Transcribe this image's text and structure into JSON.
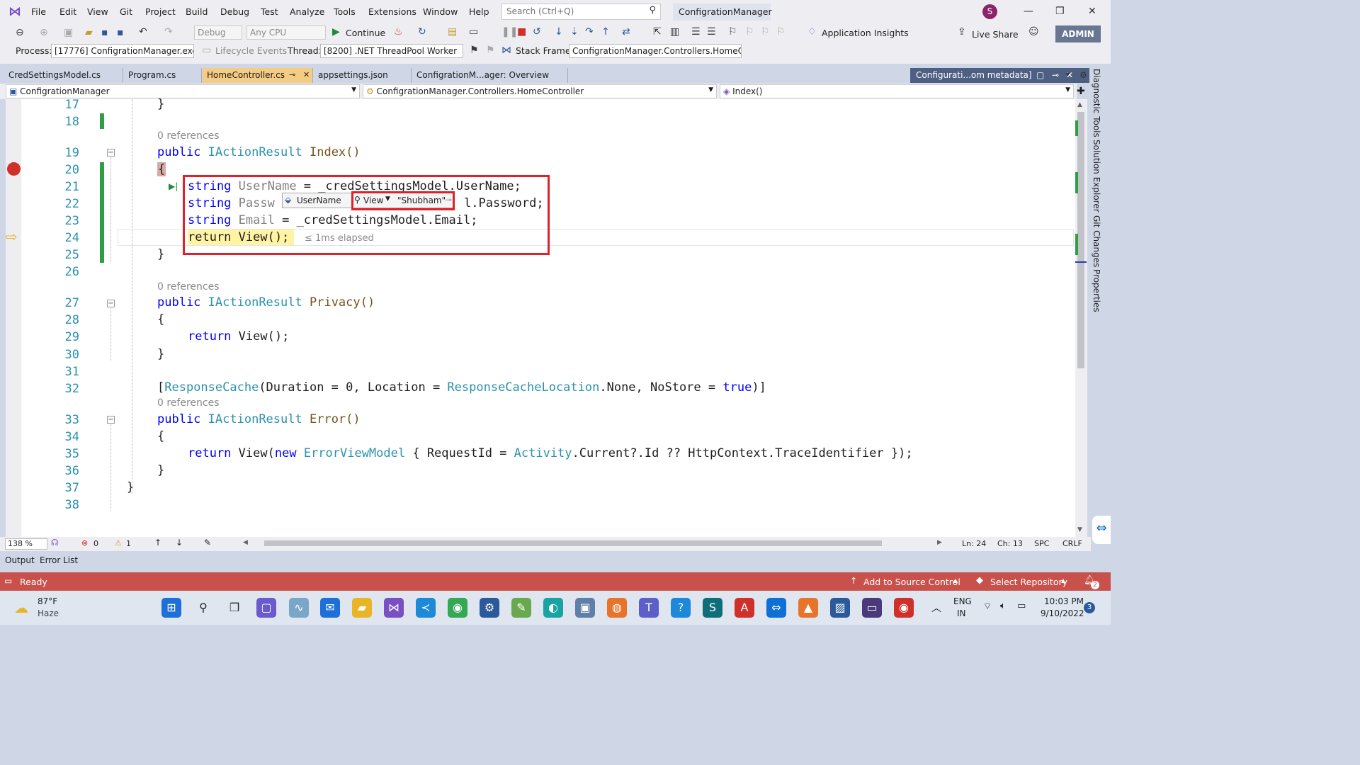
{
  "menu": [
    "File",
    "Edit",
    "View",
    "Git",
    "Project",
    "Build",
    "Debug",
    "Test",
    "Analyze",
    "Tools",
    "Extensions",
    "Window",
    "Help"
  ],
  "search_placeholder": "Search (Ctrl+Q)",
  "solution_name": "ConfigrationManager",
  "avatar_letter": "S",
  "toolbar": {
    "config": "Debug",
    "platform": "Any CPU",
    "continue": "Continue",
    "app_insights": "Application Insights",
    "live_share": "Live Share",
    "admin": "ADMIN"
  },
  "debugbar": {
    "process_label": "Process:",
    "process": "[17776] ConfigrationManager.exe",
    "lifecycle": "Lifecycle Events",
    "thread_label": "Thread:",
    "thread": "[8200] .NET ThreadPool Worker",
    "stack_label": "Stack Frame:",
    "stack": "ConfigrationManager.Controllers.HomeCc"
  },
  "tabs": [
    "CredSettingsModel.cs",
    "Program.cs",
    "HomeController.cs",
    "appsettings.json",
    "ConfigrationM...ager: Overview"
  ],
  "tab_right": "Configurati...om metadata]",
  "nav": {
    "project": "ConfigrationManager",
    "class": "ConfigrationManager.Controllers.HomeController",
    "member": "Index()"
  },
  "code": {
    "refs": "0 references",
    "l17": "}",
    "l19_kw": "public",
    "l19_ty": "IActionResult",
    "l19_mt": "Index()",
    "l21": [
      "string",
      "UserName",
      " = _credSettingsModel.UserName;"
    ],
    "l22": [
      "string",
      "Passw",
      "l.Password;"
    ],
    "l23": [
      "string",
      "Email",
      " = _credSettingsModel.Email;"
    ],
    "l24": "return View();",
    "elapsed": "≤ 1ms elapsed",
    "l27_mt": "Privacy()",
    "l29": [
      "return",
      " View();"
    ],
    "l32": [
      "[",
      "ResponseCache",
      "(Duration = 0, Location = ",
      "ResponseCacheLocation",
      ".None, NoStore = ",
      "true",
      ")]"
    ],
    "l33_mt": "Error()",
    "l35": [
      "return",
      " View(",
      "new",
      " ",
      "ErrorViewModel",
      " { RequestId = ",
      "Activity",
      ".Current?.Id ?? HttpContext.TraceIdentifier });"
    ],
    "brace_open": "{",
    "brace_close": "}"
  },
  "line_numbers": [
    "17",
    "18",
    "19",
    "20",
    "21",
    "22",
    "23",
    "24",
    "25",
    "26",
    "27",
    "28",
    "29",
    "30",
    "31",
    "32",
    "33",
    "34",
    "35",
    "36",
    "37",
    "38"
  ],
  "tooltip": {
    "name": "UserName",
    "view": "View",
    "value": "\"Shubham\""
  },
  "editor_status": {
    "zoom": "138 %",
    "errors": "0",
    "warnings": "1",
    "ln": "Ln: 24",
    "ch": "Ch: 13",
    "spc": "SPC",
    "crlf": "CRLF"
  },
  "bottom_tabs": [
    "Output",
    "Error List"
  ],
  "status": {
    "ready": "Ready",
    "source_control": "Add to Source Control",
    "repo": "Select Repository",
    "notif": "2"
  },
  "side_tabs": [
    "Diagnostic Tools",
    "Solution Explorer",
    "Git Changes",
    "Properties"
  ],
  "weather": {
    "temp": "87°F",
    "desc": "Haze"
  },
  "tray": {
    "lang1": "ENG",
    "lang2": "IN",
    "time": "10:03 PM",
    "date": "9/10/2022",
    "badge": "3"
  }
}
